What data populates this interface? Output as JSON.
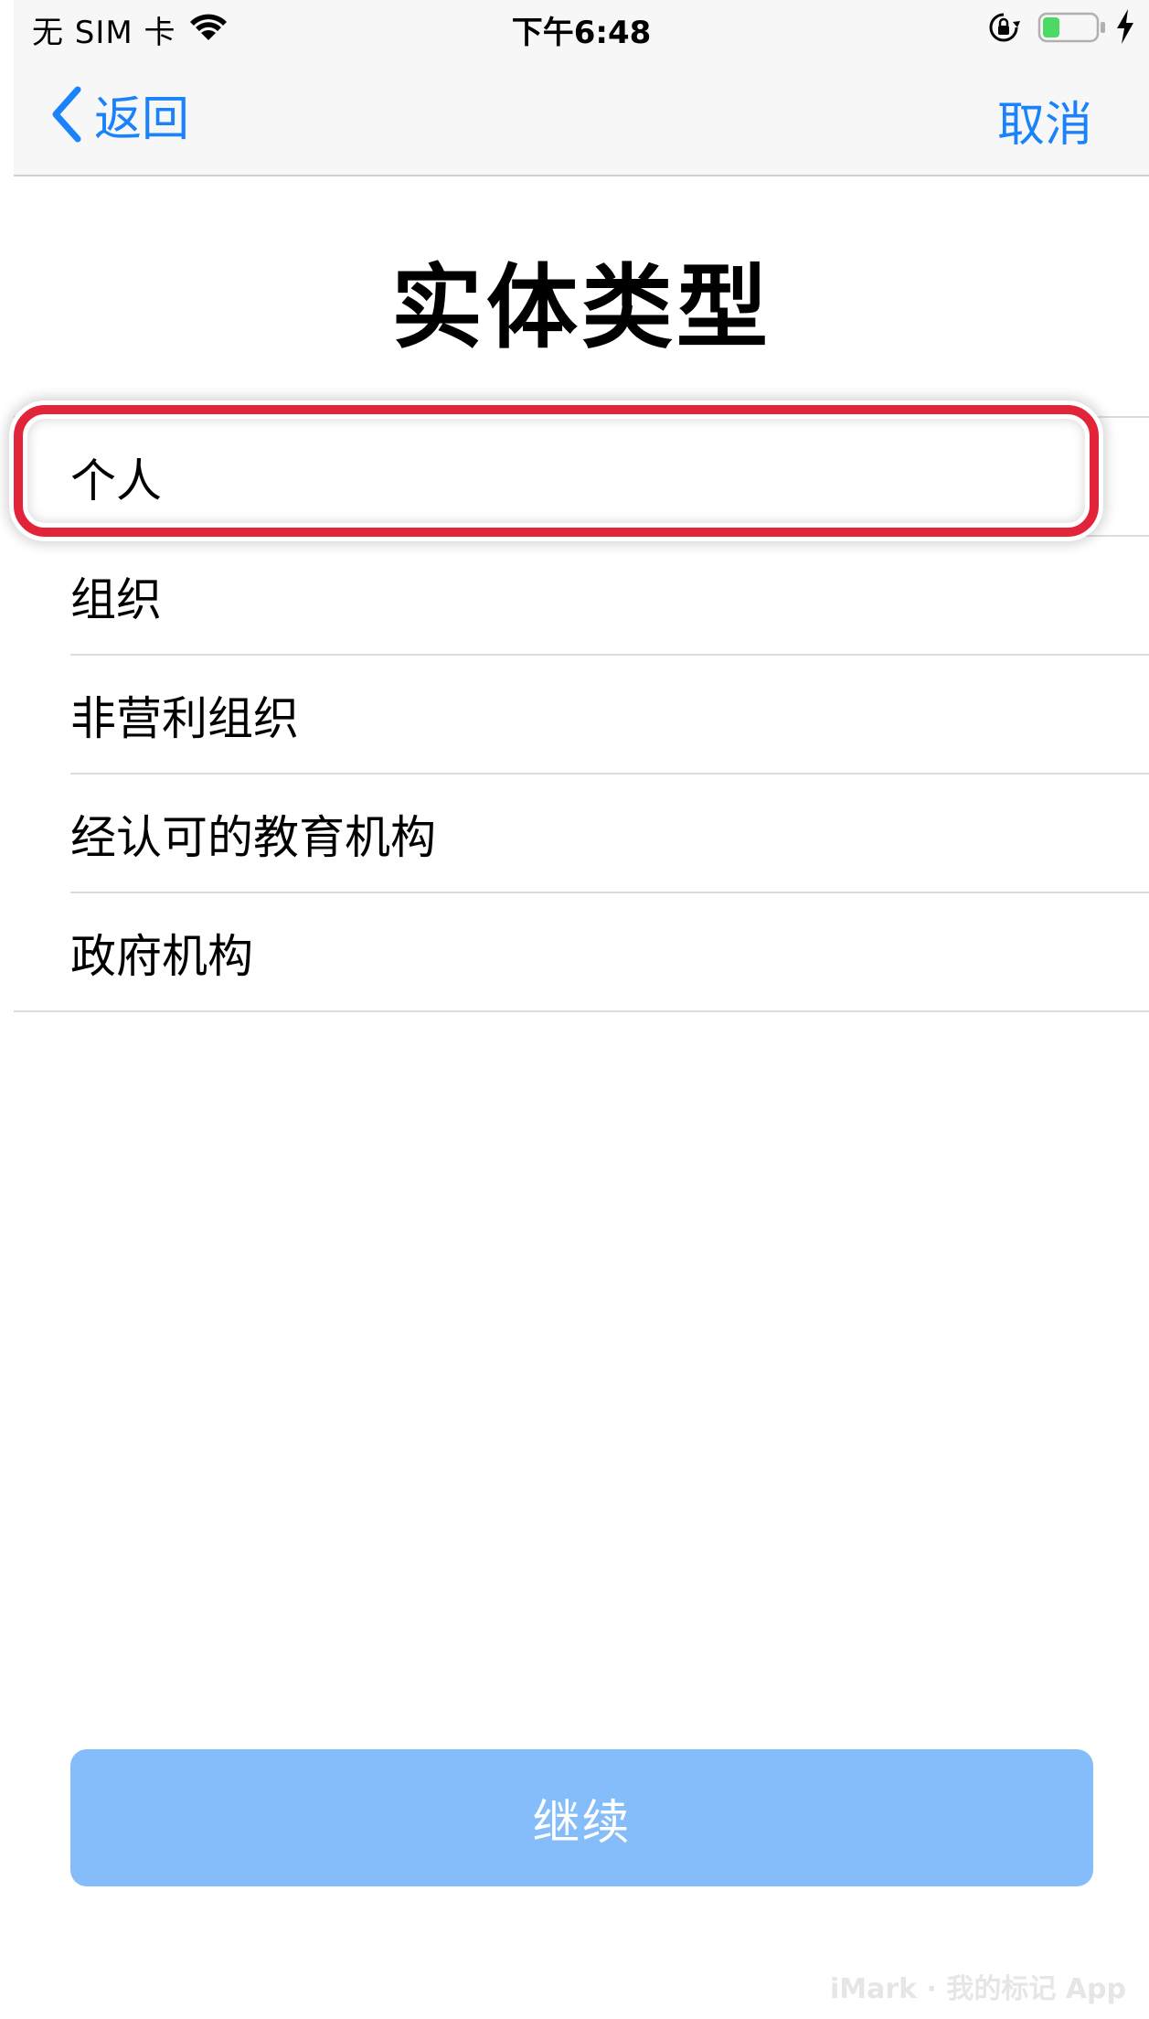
{
  "status_bar": {
    "carrier": "无 SIM 卡",
    "time": "下午6:48",
    "battery_color": "#4cd964"
  },
  "nav": {
    "back_label": "返回",
    "cancel_label": "取消",
    "accent_color": "#1a82fb"
  },
  "page": {
    "title": "实体类型"
  },
  "entity_types": [
    {
      "label": "个人",
      "highlighted": true
    },
    {
      "label": "组织"
    },
    {
      "label": "非营利组织"
    },
    {
      "label": "经认可的教育机构"
    },
    {
      "label": "政府机构"
    }
  ],
  "actions": {
    "continue_label": "继续",
    "continue_color": "#84bdf9"
  },
  "watermark": "iMark · 我的标记 App"
}
